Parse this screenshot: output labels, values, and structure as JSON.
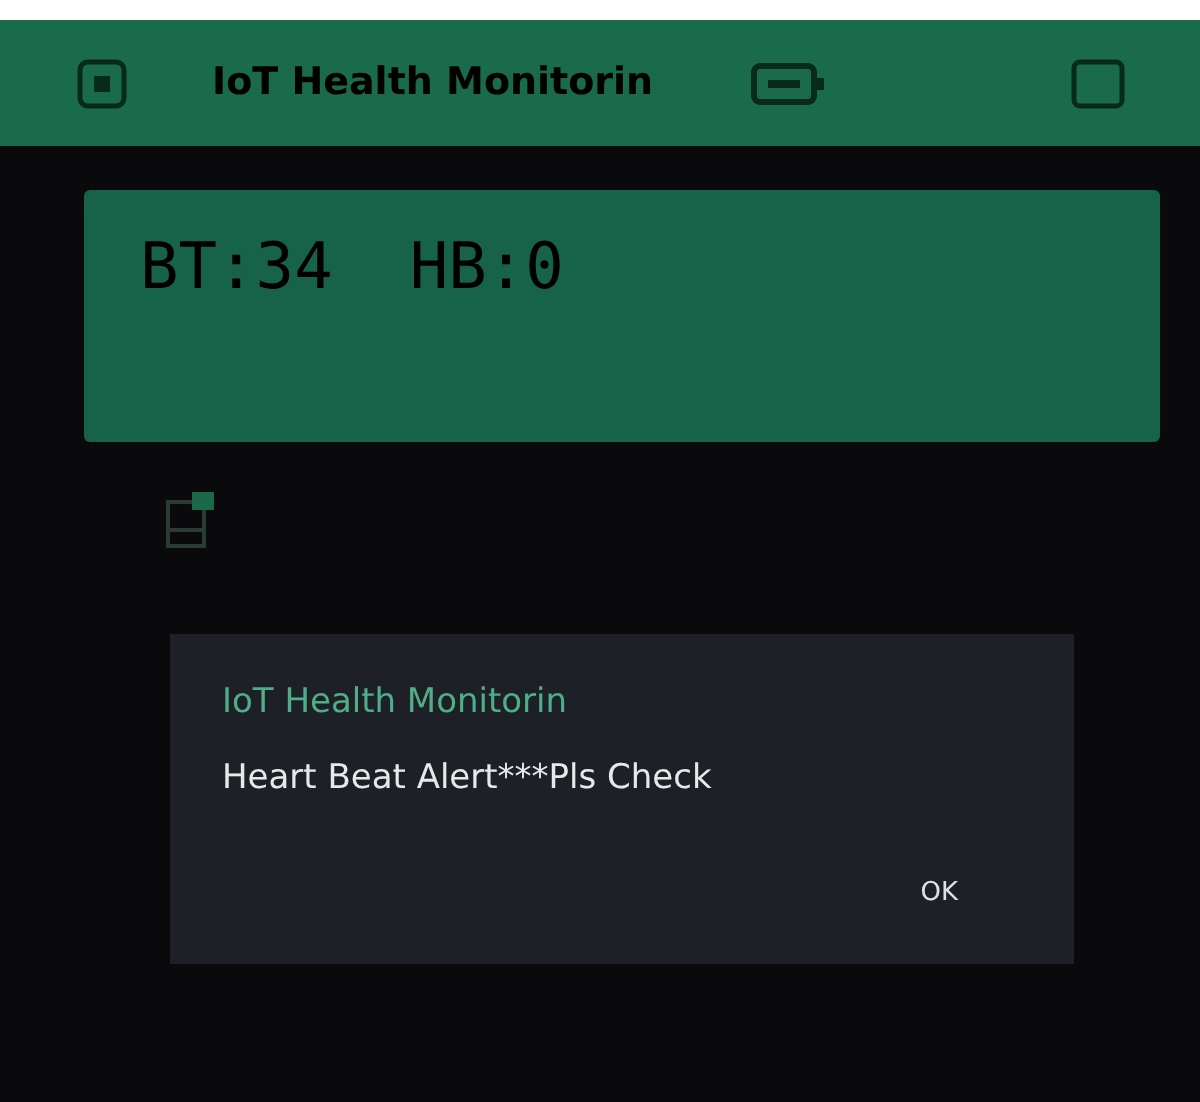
{
  "app_bar": {
    "title": "IoT Health Monitorin"
  },
  "lcd": {
    "lines": [
      "BT:34  HB:0"
    ]
  },
  "dialog": {
    "title": "IoT Health Monitorin",
    "message": "Heart Beat Alert***Pls Check",
    "buttons": [
      "OK"
    ]
  }
}
